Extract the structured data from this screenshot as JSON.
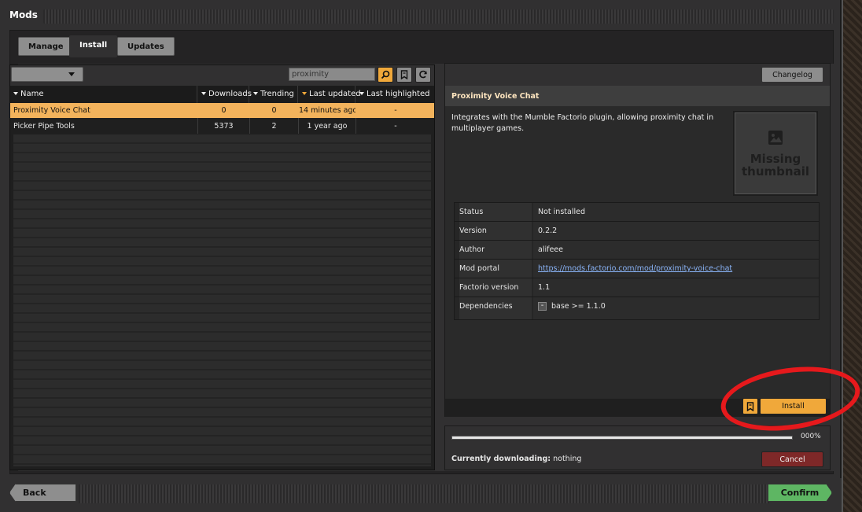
{
  "window": {
    "title": "Mods"
  },
  "tabs": [
    {
      "label": "Manage"
    },
    {
      "label": "Install"
    },
    {
      "label": "Updates"
    }
  ],
  "toolbar": {
    "search_value": "proximity"
  },
  "table": {
    "columns": [
      "Name",
      "Downloads",
      "Trending",
      "Last updated",
      "Last highlighted"
    ],
    "rows": [
      {
        "name": "Proximity Voice Chat",
        "downloads": "0",
        "trending": "0",
        "last_updated": "14 minutes ago",
        "last_highlighted": "-"
      },
      {
        "name": "Picker Pipe Tools",
        "downloads": "5373",
        "trending": "2",
        "last_updated": "1 year ago",
        "last_highlighted": "-"
      }
    ]
  },
  "details": {
    "changelog_label": "Changelog",
    "mod_name": "Proximity Voice Chat",
    "description": "Integrates with the Mumble Factorio plugin, allowing proximity chat in multiplayer games.",
    "thumbnail_text": "Missing thumbnail",
    "info": [
      {
        "key": "Status",
        "value": "Not installed"
      },
      {
        "key": "Version",
        "value": "0.2.2"
      },
      {
        "key": "Author",
        "value": "alifeee"
      },
      {
        "key": "Mod portal",
        "value": "https://mods.factorio.com/mod/proximity-voice-chat"
      },
      {
        "key": "Factorio version",
        "value": "1.1"
      },
      {
        "key": "Dependencies",
        "value": "base >= 1.1.0"
      }
    ],
    "install_label": "Install"
  },
  "download": {
    "progress_percent": 0,
    "progress_text": "000%",
    "label": "Currently downloading:",
    "value": "nothing",
    "cancel_label": "Cancel"
  },
  "footer": {
    "back_label": "Back",
    "confirm_label": "Confirm"
  },
  "colors": {
    "accent": "#f0a83a",
    "confirm": "#5eb663",
    "cancel": "#7e2828",
    "annotation": "#e6191c"
  }
}
